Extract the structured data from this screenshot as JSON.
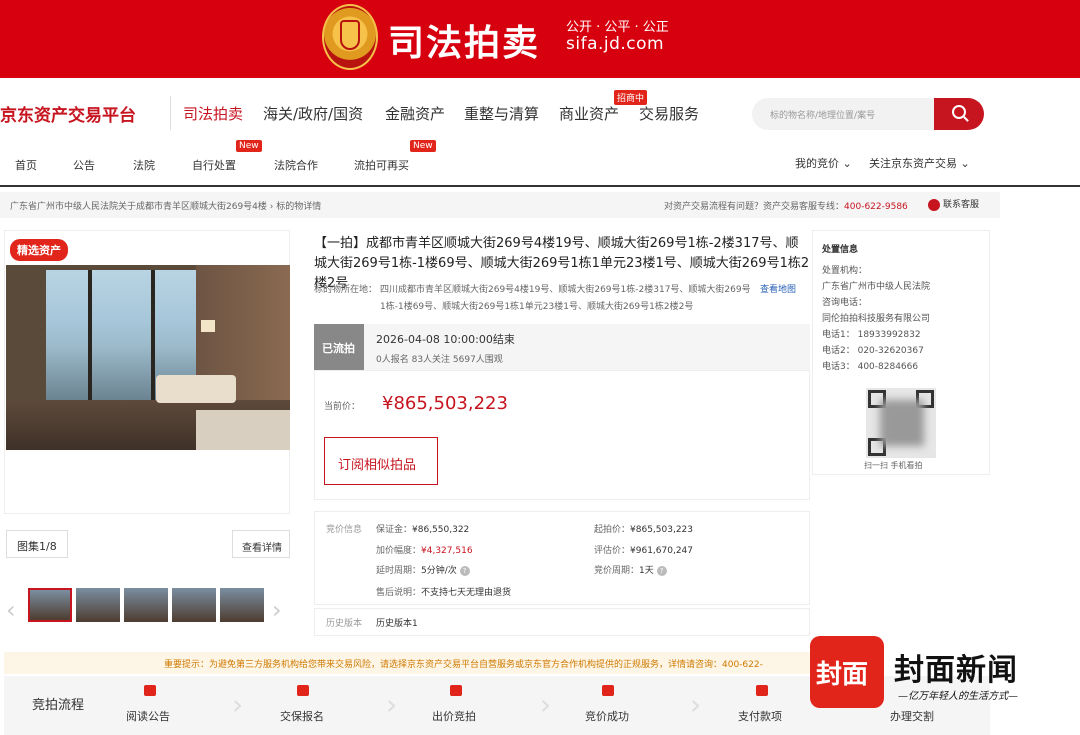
{
  "banner": {
    "title": "司法拍卖",
    "slogan": "公开 · 公平 · 公正",
    "domain": "sifa.jd.com"
  },
  "nav": {
    "brand": "京东资产交易平台",
    "items": [
      "司法拍卖",
      "海关/政府/国资",
      "金融资产",
      "重整与清算",
      "商业资产",
      "交易服务"
    ],
    "badge_commercial": "招商中",
    "search_placeholder": "标的物名称/地理位置/案号"
  },
  "subnav": {
    "items": [
      "首页",
      "公告",
      "法院",
      "自行处置",
      "法院合作",
      "流拍可再买"
    ],
    "new_badge": "New",
    "my_bids": "我的竞价 ⌄",
    "follow": "关注京东资产交易 ⌄"
  },
  "breadcrumb": {
    "path": "广东省广州市中级人民法院关于成都市青羊区顺城大街269号4楼  ›  标的物详情",
    "help_text": "对资产交易流程有问题？资产交易客服专线：",
    "help_phone": "400-622-9586",
    "service": "联系客服"
  },
  "gallery": {
    "badge": "精选资产",
    "count": "图集1/8",
    "detail": "查看详情"
  },
  "item": {
    "title": "【一拍】成都市青羊区顺城大街269号4楼19号、顺城大街269号1栋-2楼317号、顺城大街269号1栋-1楼69号、顺城大街269号1栋1单元23楼1号、顺城大街269号1栋2楼2号",
    "addr_label": "标的物所在地：",
    "addr_text": "四川成都市青羊区顺城大街269号4楼19号、顺城大街269号1栋-2楼317号、顺城大街269号1栋-1楼69号、顺城大街269号1栋1单元23楼1号、顺城大街269号1栋2楼2号",
    "map_link": "查看地图",
    "status": "已流拍",
    "end_time": "2026-04-08  10:00:00结束",
    "stats": "0人报名  83人关注  5697人围观",
    "price_label": "当前价：",
    "price": "¥865,503,223",
    "subscribe": "订阅相似拍品"
  },
  "fees": {
    "section_label": "竞价信息",
    "deposit_label": "保证金：",
    "deposit": "¥86,550,322",
    "start_label": "起拍价：",
    "start": "¥865,503,223",
    "increment_label": "加价幅度：",
    "increment": "¥4,327,516",
    "appraise_label": "评估价：",
    "appraise": "¥961,670,247",
    "delay_label": "延时周期：",
    "delay": "5分钟/次",
    "cycle_label": "竞价周期：",
    "cycle": "1天",
    "after_label": "售后说明：",
    "after": "不支持七天无理由退货"
  },
  "history": {
    "label": "历史版本",
    "value": "历史版本1"
  },
  "disposal": {
    "title": "处置信息",
    "org_label": "处置机构：",
    "org": "广东省广州市中级人民法院",
    "consult_label": "咨询电话：",
    "company": "同伦拍拍科技服务有限公司",
    "phone1": "电话1：  18933992832",
    "phone2": "电话2：  020-32620367",
    "phone3": "电话3：  400-8284666",
    "qr_caption": "扫一扫  手机看拍"
  },
  "notice": {
    "text": "重要提示：为避免第三方服务机构给您带来交易风险，请选择京东资产交易平台自营服务或京东官方合作机构提供的正规服务，详情请咨询：400-622-"
  },
  "process": {
    "title": "竞拍流程",
    "steps": [
      "阅读公告",
      "交保报名",
      "出价竞拍",
      "竞价成功",
      "支付款项",
      "办理交割"
    ]
  },
  "watermark": {
    "mark": "封面",
    "name": "封面新闻",
    "slogan": "—亿万年轻人的生活方式—"
  },
  "colors": {
    "brand_red": "#d7000f",
    "accent_red": "#c71520",
    "link_blue": "#2a62b6"
  }
}
